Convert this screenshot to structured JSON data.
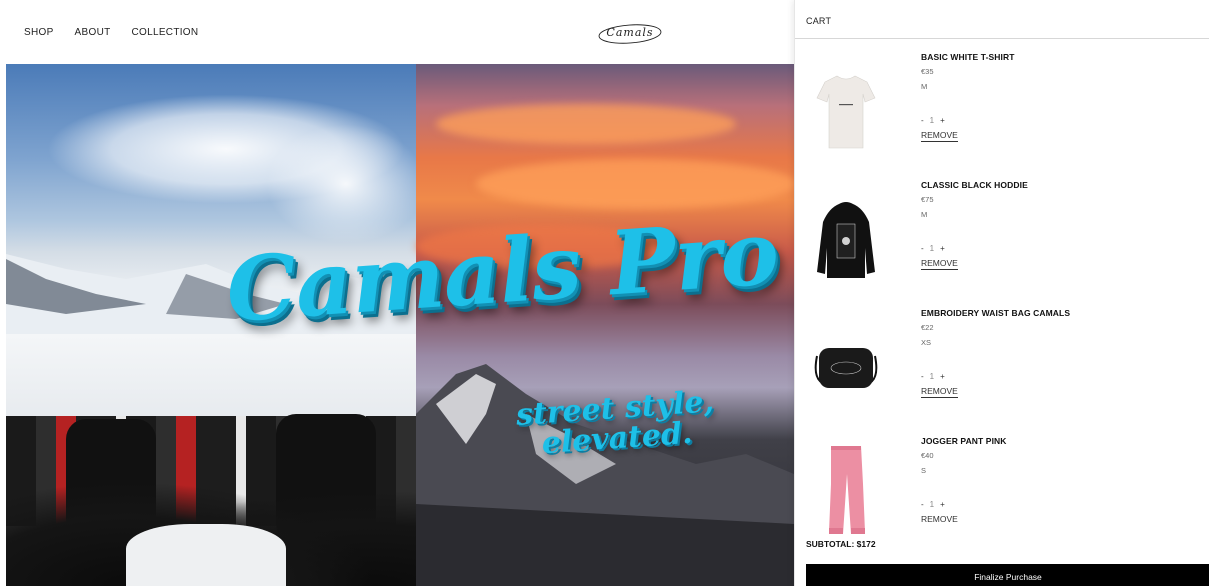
{
  "nav": {
    "items": [
      "SHOP",
      "ABOUT",
      "COLLECTION"
    ]
  },
  "brand": {
    "logo_text": "Camals"
  },
  "hero": {
    "title": "Camals Pro",
    "subtitle_line1": "street style,",
    "subtitle_line2": "elevated."
  },
  "cart": {
    "title": "CART",
    "items": [
      {
        "name": "BASIC WHITE T-SHIRT",
        "price": "€35",
        "size": "M",
        "qty_minus": "-",
        "qty": "1",
        "qty_plus": "+",
        "remove": "REMOVE",
        "color": "#eeeae6"
      },
      {
        "name": "CLASSIC BLACK HODDIE",
        "price": "€75",
        "size": "M",
        "qty_minus": "-",
        "qty": "1",
        "qty_plus": "+",
        "remove": "REMOVE",
        "color": "#111111"
      },
      {
        "name": "EMBROIDERY WAIST BAG CAMALS",
        "price": "€22",
        "size": "XS",
        "qty_minus": "-",
        "qty": "1",
        "qty_plus": "+",
        "remove": "REMOVE",
        "color": "#1a1a1a"
      },
      {
        "name": "JOGGER PANT PINK",
        "price": "€40",
        "size": "S",
        "qty_minus": "-",
        "qty": "1",
        "qty_plus": "+",
        "remove": "REMOVE",
        "color": "#ec8fa3"
      }
    ],
    "subtotal": "SUBTOTAL: $172",
    "finalize_label": "Finalize Purchase"
  },
  "colors": {
    "accent_cyan": "#1ec0e8",
    "button_black": "#000000"
  }
}
